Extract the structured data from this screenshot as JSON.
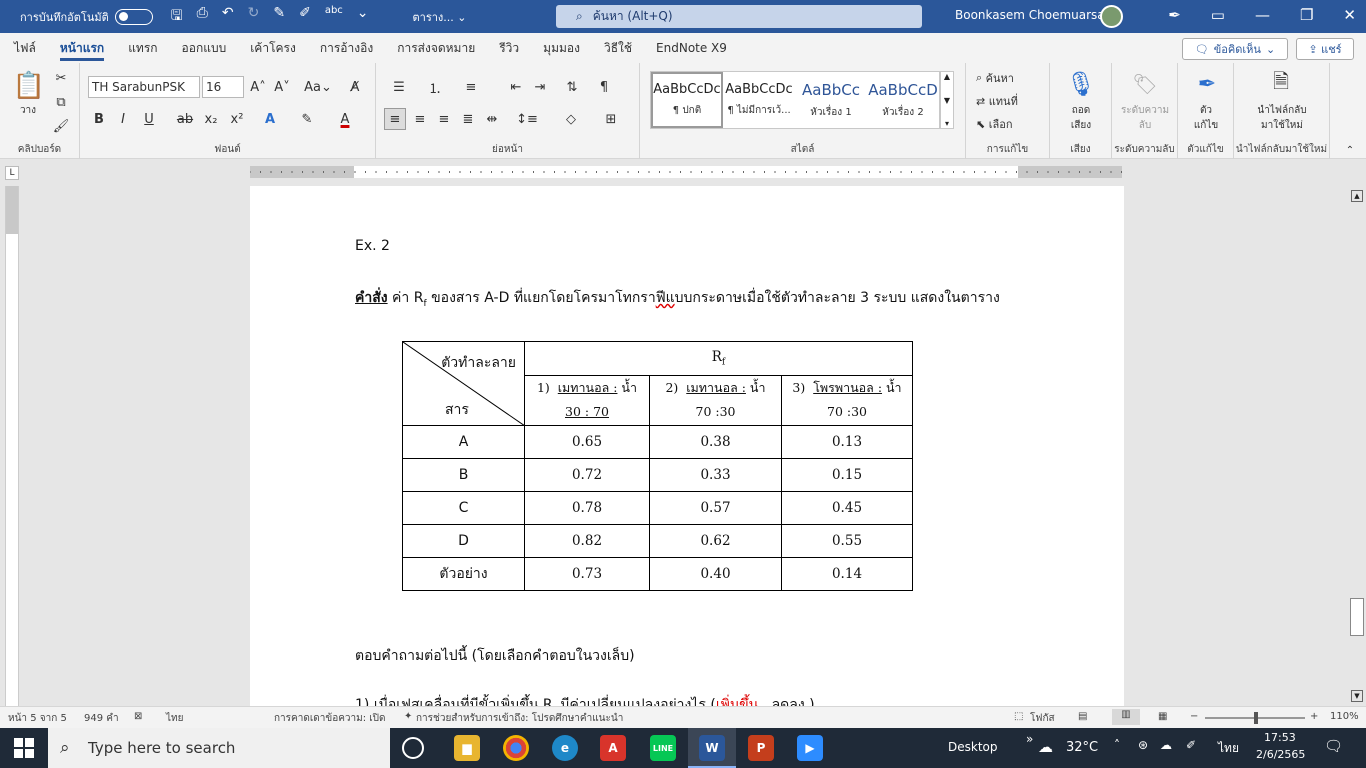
{
  "titlebar": {
    "autosave_label": "การบันทึกอัตโนมัติ",
    "doc_name": "ตาราง...",
    "search_placeholder": "ค้นหา (Alt+Q)",
    "user_name": "Boonkasem Choemuarsat"
  },
  "menu": {
    "tabs": [
      "ไฟล์",
      "หน้าแรก",
      "แทรก",
      "ออกแบบ",
      "เค้าโครง",
      "การอ้างอิง",
      "การส่งจดหมาย",
      "รีวิว",
      "มุมมอง",
      "วิธีใช้",
      "EndNote X9"
    ],
    "active_index": 1,
    "comment_label": "ข้อคิดเห็น",
    "share_label": "แชร์"
  },
  "ribbon": {
    "clipboard": {
      "paste_label": "วาง",
      "group_label": "คลิปบอร์ด"
    },
    "font": {
      "font_name": "TH SarabunPSK",
      "font_size": "16",
      "group_label": "ฟอนต์"
    },
    "paragraph": {
      "group_label": "ย่อหน้า"
    },
    "styles": {
      "items": [
        {
          "preview": "AaBbCcDc",
          "name": "¶ ปกติ"
        },
        {
          "preview": "AaBbCcDc",
          "name": "¶ ไม่มีการเว้..."
        },
        {
          "preview": "AaBbCc",
          "name": "หัวเรื่อง 1"
        },
        {
          "preview": "AaBbCcD",
          "name": "หัวเรื่อง 2"
        }
      ],
      "group_label": "สไตล์"
    },
    "editing": {
      "find": "ค้นหา",
      "replace": "แทนที่",
      "select": "เลือก",
      "group_label": "การแก้ไข"
    },
    "voice": {
      "dictate": "ถอด\nเสียง",
      "group_label": "เสียง"
    },
    "sensitivity": {
      "label": "ระดับความ\nลับ",
      "group_label": "ระดับความลับ"
    },
    "editor": {
      "label": "ตัว\nแก้ไข",
      "group_label": "ตัวแก้ไข"
    },
    "reuse": {
      "label": "นำไฟล์กลับ\nมาใช้ใหม่",
      "group_label": "นำไฟล์กลับมาใช้ใหม่"
    }
  },
  "document": {
    "ex_title": "Ex. 2",
    "instruction_bold": "คำสั่ง",
    "instruction_a": " ค่า R",
    "instruction_sub": "f",
    "instruction_b": " ของสาร A-D ที่แยกโดยโครมาโทกรา",
    "instruction_err": "ฟีแ",
    "instruction_c": "บบกระดาษเมื่อใช้ตัวทำละลาย 3 ระบบ แสดงในตาราง",
    "table": {
      "header_solvent": "ตัวทำละลาย",
      "header_substance": "สาร",
      "header_rf": "R",
      "header_rf_sub": "f",
      "solvents": [
        {
          "num": "1)",
          "name": "เมทานอล :",
          "rest": " น้ำ",
          "ratio": "30 : 70"
        },
        {
          "num": "2)",
          "name": "เมทานอล :",
          "rest": " น้ำ",
          "ratio": "70 :30"
        },
        {
          "num": "3)",
          "name": "โพรพานอล :",
          "rest": " น้ำ",
          "ratio": "70 :30"
        }
      ],
      "rows": [
        {
          "label": "A",
          "values": [
            "0.65",
            "0.38",
            "0.13"
          ]
        },
        {
          "label": "B",
          "values": [
            "0.72",
            "0.33",
            "0.15"
          ]
        },
        {
          "label": "C",
          "values": [
            "0.78",
            "0.57",
            "0.45"
          ]
        },
        {
          "label": "D",
          "values": [
            "0.82",
            "0.62",
            "0.55"
          ]
        },
        {
          "label": "ตัวอย่าง",
          "values": [
            "0.73",
            "0.40",
            "0.14"
          ]
        }
      ]
    },
    "question_intro": "ตอบคำถามต่อไปนี้ (โดยเลือกคำตอบในวงเล็บ)",
    "q1_a": "1) เมื่อเฟสเคลื่อนที่มีขั้วเพิ่มขึ้น R",
    "q1_sub": "f",
    "q1_b": " มีค่าเปลี่ยนแปลงอย่างไร (",
    "q1_opt1": "เพิ่มขึ้น",
    "q1_c": " , ลดลง )"
  },
  "status": {
    "page": "หน้า 5 จาก 5",
    "words": "949 คำ",
    "language": "ไทย",
    "prediction": "การคาดเดาข้อความ: เปิด",
    "accessibility": "การช่วยสำหรับการเข้าถึง: โปรดศึกษาคำแนะนำ",
    "focus": "โฟกัส",
    "zoom": "110%"
  },
  "taskbar": {
    "search_placeholder": "Type here to search",
    "desktop_label": "Desktop",
    "temperature": "32°C",
    "ime": "ไทย",
    "time": "17:53",
    "date": "2/6/2565"
  },
  "colors": {
    "word_blue": "#2b579a",
    "taskbar": "#1f2a38",
    "error_red": "#d00000"
  }
}
